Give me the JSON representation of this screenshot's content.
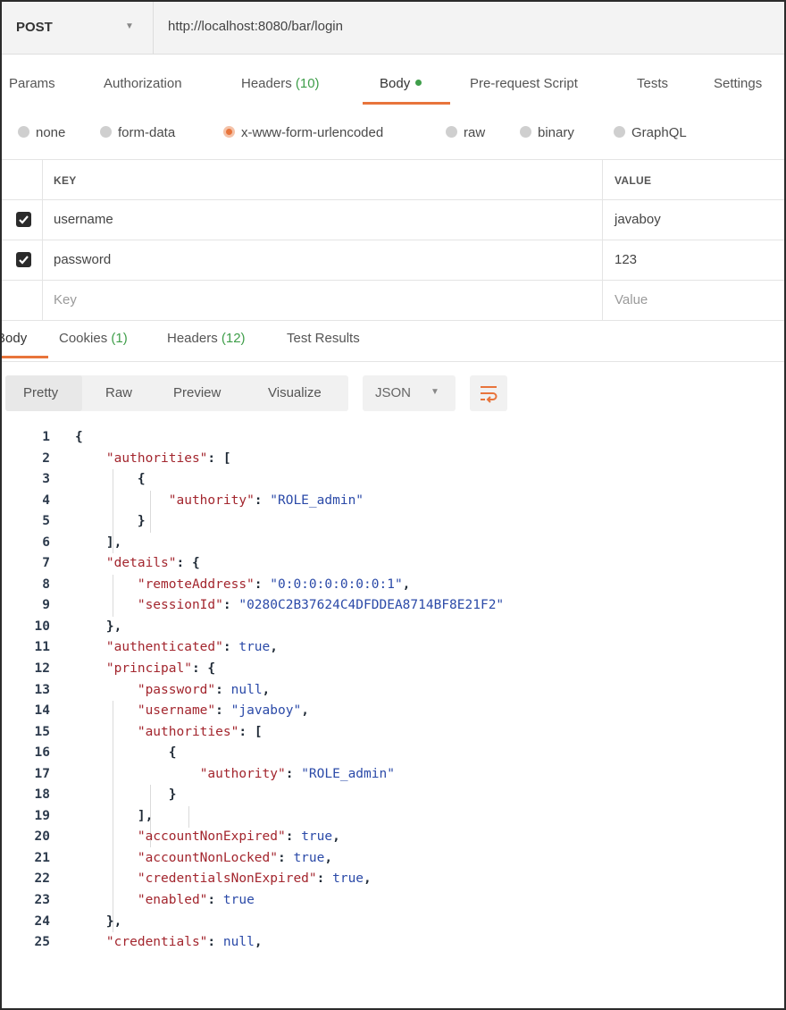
{
  "request": {
    "method": "POST",
    "url": "http://localhost:8080/bar/login"
  },
  "request_tabs": [
    {
      "label": "Params"
    },
    {
      "label": "Authorization"
    },
    {
      "label": "Headers",
      "count": "(10)"
    },
    {
      "label": "Body",
      "active": true
    },
    {
      "label": "Pre-request Script"
    },
    {
      "label": "Tests"
    },
    {
      "label": "Settings"
    }
  ],
  "body_types": [
    {
      "label": "none"
    },
    {
      "label": "form-data"
    },
    {
      "label": "x-www-form-urlencoded",
      "selected": true
    },
    {
      "label": "raw"
    },
    {
      "label": "binary"
    },
    {
      "label": "GraphQL"
    }
  ],
  "params_table": {
    "headers": {
      "key": "KEY",
      "value": "VALUE"
    },
    "rows": [
      {
        "checked": true,
        "key": "username",
        "value": "javaboy"
      },
      {
        "checked": true,
        "key": "password",
        "value": "123"
      }
    ],
    "placeholder": {
      "key": "Key",
      "value": "Value"
    }
  },
  "response_tabs": [
    {
      "label": "Body",
      "active": true
    },
    {
      "label": "Cookies",
      "count": "(1)"
    },
    {
      "label": "Headers",
      "count": "(12)"
    },
    {
      "label": "Test Results"
    }
  ],
  "format_tabs": [
    {
      "label": "Pretty",
      "active": true
    },
    {
      "label": "Raw"
    },
    {
      "label": "Preview"
    },
    {
      "label": "Visualize"
    }
  ],
  "format_select": "JSON",
  "colors": {
    "accent": "#e8743b",
    "count_green": "#3f9e4a",
    "json_key": "#a3262e",
    "json_value": "#2b4aa8"
  },
  "icons": {
    "wrap": "wrap-lines-icon",
    "check": "checkbox-checked-icon",
    "caret": "chevron-down-icon"
  },
  "code_lines": [
    {
      "num": "1",
      "text": "{"
    },
    {
      "num": "2",
      "text": "    \"authorities\": ["
    },
    {
      "num": "3",
      "text": "        {"
    },
    {
      "num": "4",
      "text": "            \"authority\": \"ROLE_admin\""
    },
    {
      "num": "5",
      "text": "        }"
    },
    {
      "num": "6",
      "text": "    ],"
    },
    {
      "num": "7",
      "text": "    \"details\": {"
    },
    {
      "num": "8",
      "text": "        \"remoteAddress\": \"0:0:0:0:0:0:0:1\","
    },
    {
      "num": "9",
      "text": "        \"sessionId\": \"0280C2B37624C4DFDDEA8714BF8E21F2\""
    },
    {
      "num": "10",
      "text": "    },"
    },
    {
      "num": "11",
      "text": "    \"authenticated\": true,"
    },
    {
      "num": "12",
      "text": "    \"principal\": {"
    },
    {
      "num": "13",
      "text": "        \"password\": null,"
    },
    {
      "num": "14",
      "text": "        \"username\": \"javaboy\","
    },
    {
      "num": "15",
      "text": "        \"authorities\": ["
    },
    {
      "num": "16",
      "text": "            {"
    },
    {
      "num": "17",
      "text": "                \"authority\": \"ROLE_admin\""
    },
    {
      "num": "18",
      "text": "            }"
    },
    {
      "num": "19",
      "text": "        ],"
    },
    {
      "num": "20",
      "text": "        \"accountNonExpired\": true,"
    },
    {
      "num": "21",
      "text": "        \"accountNonLocked\": true,"
    },
    {
      "num": "22",
      "text": "        \"credentialsNonExpired\": true,"
    },
    {
      "num": "23",
      "text": "        \"enabled\": true"
    },
    {
      "num": "24",
      "text": "    },"
    },
    {
      "num": "25",
      "text": "    \"credentials\": null,"
    }
  ]
}
